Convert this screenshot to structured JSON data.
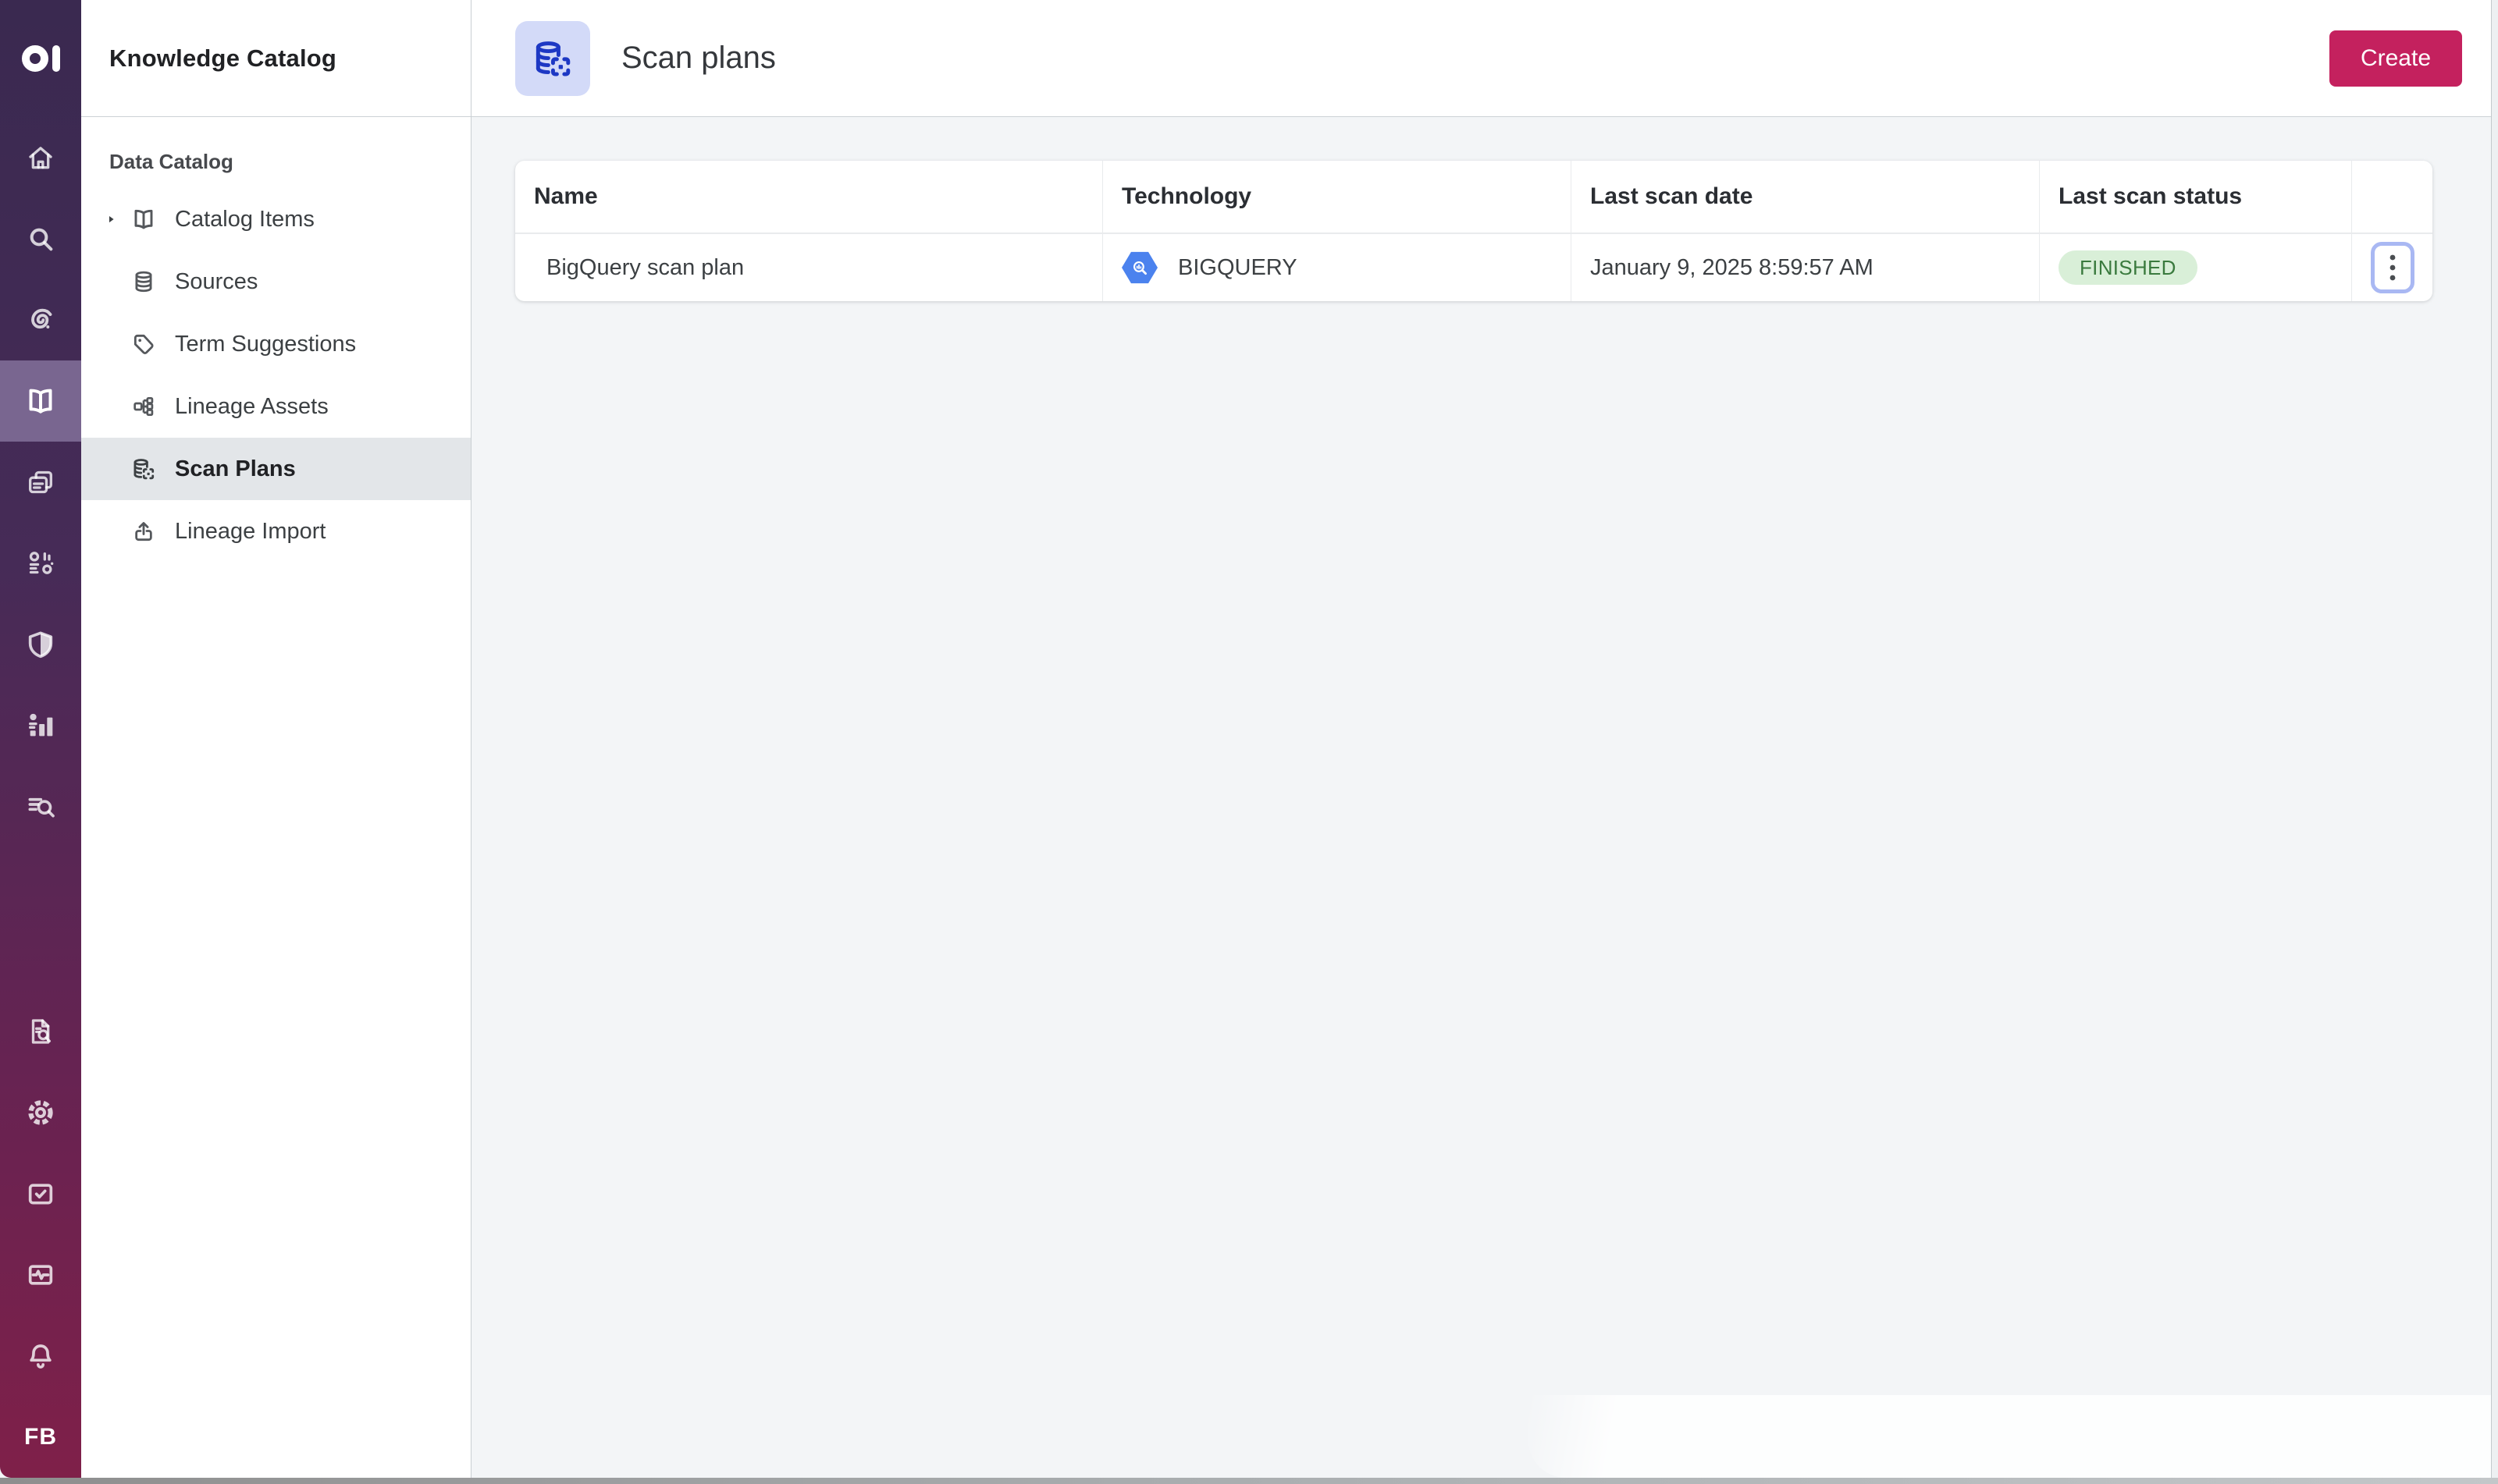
{
  "app": {
    "brand_logo": "ataccama-logo",
    "user_initials": "FB"
  },
  "colors": {
    "rail_gradient_top": "#3a2950",
    "rail_gradient_bottom": "#7f2049",
    "rail_active_bg": "#796690",
    "sidebar_active_bg": "#e3e6e9",
    "accent_create": "#c4215e",
    "page_icon_tile_bg": "#d3daf8",
    "page_icon_blue": "#1d38c4",
    "status_finished_bg": "#d9efd8",
    "status_finished_text": "#3a7a3e",
    "bigquery_blue": "#4b82ee",
    "kebab_focus_border": "#a9b8f3",
    "content_bg": "#f3f5f7"
  },
  "rail": {
    "top_items": [
      {
        "icon": "home-icon",
        "active": false
      },
      {
        "icon": "search-icon",
        "active": false
      },
      {
        "icon": "profiling-spiral-icon",
        "active": false
      },
      {
        "icon": "knowledge-catalog-book-icon",
        "active": true
      },
      {
        "icon": "folders-icon",
        "active": false
      },
      {
        "icon": "components-icon",
        "active": false
      },
      {
        "icon": "shield-icon",
        "active": false
      },
      {
        "icon": "reports-chart-icon",
        "active": false
      },
      {
        "icon": "list-search-icon",
        "active": false
      }
    ],
    "bottom_items": [
      {
        "icon": "document-search-icon"
      },
      {
        "icon": "gear-icon"
      },
      {
        "icon": "checkbox-icon"
      },
      {
        "icon": "monitoring-pulse-icon"
      },
      {
        "icon": "bell-icon"
      }
    ]
  },
  "sidebar": {
    "title": "Knowledge Catalog",
    "section": "Data Catalog",
    "items": [
      {
        "label": "Catalog Items",
        "icon": "book-open-icon",
        "expandable": true,
        "active": false
      },
      {
        "label": "Sources",
        "icon": "database-icon",
        "expandable": false,
        "active": false
      },
      {
        "label": "Term Suggestions",
        "icon": "tag-icon",
        "expandable": false,
        "active": false
      },
      {
        "label": "Lineage Assets",
        "icon": "lineage-icon",
        "expandable": false,
        "active": false
      },
      {
        "label": "Scan Plans",
        "icon": "scan-plan-icon",
        "expandable": false,
        "active": true
      },
      {
        "label": "Lineage Import",
        "icon": "upload-icon",
        "expandable": false,
        "active": false
      }
    ]
  },
  "page": {
    "title": "Scan plans",
    "icon": "scan-plan-icon",
    "create_label": "Create"
  },
  "table": {
    "columns": [
      "Name",
      "Technology",
      "Last scan date",
      "Last scan status",
      ""
    ],
    "rows": [
      {
        "name": "BigQuery scan plan",
        "technology": "BIGQUERY",
        "technology_icon": "bigquery-icon",
        "last_scan_date": "January 9, 2025 8:59:57 AM",
        "status": "FINISHED"
      }
    ]
  }
}
